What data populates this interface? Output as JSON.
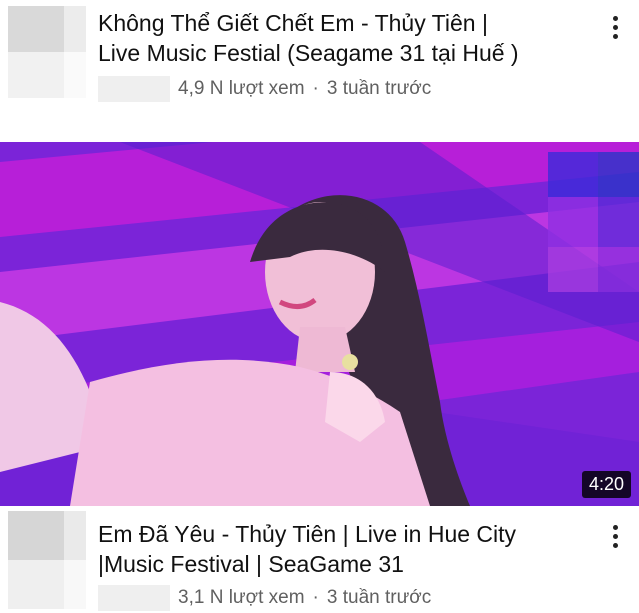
{
  "videos": [
    {
      "title_line1": "Không Thể Giết Chết Em - Thủy Tiên |",
      "title_line2": "Live Music Festial (Seagame 31 tại Huế )",
      "views": "4,9 N lượt xem",
      "separator": "·",
      "age": "3 tuần trước"
    },
    {
      "title_line1": "Em Đã Yêu - Thủy Tiên | Live in Hue City",
      "title_line2": "|Music Festival | SeaGame 31",
      "views": "3,1 N lượt xem",
      "separator": "·",
      "age": "3 tuần trước",
      "duration": "4:20"
    }
  ],
  "colors": {
    "thumbnail_bg": "#7b24d8",
    "stage_light": "#c21fd8",
    "meta_text": "#606060"
  },
  "icons": [
    "more-vert-icon"
  ]
}
